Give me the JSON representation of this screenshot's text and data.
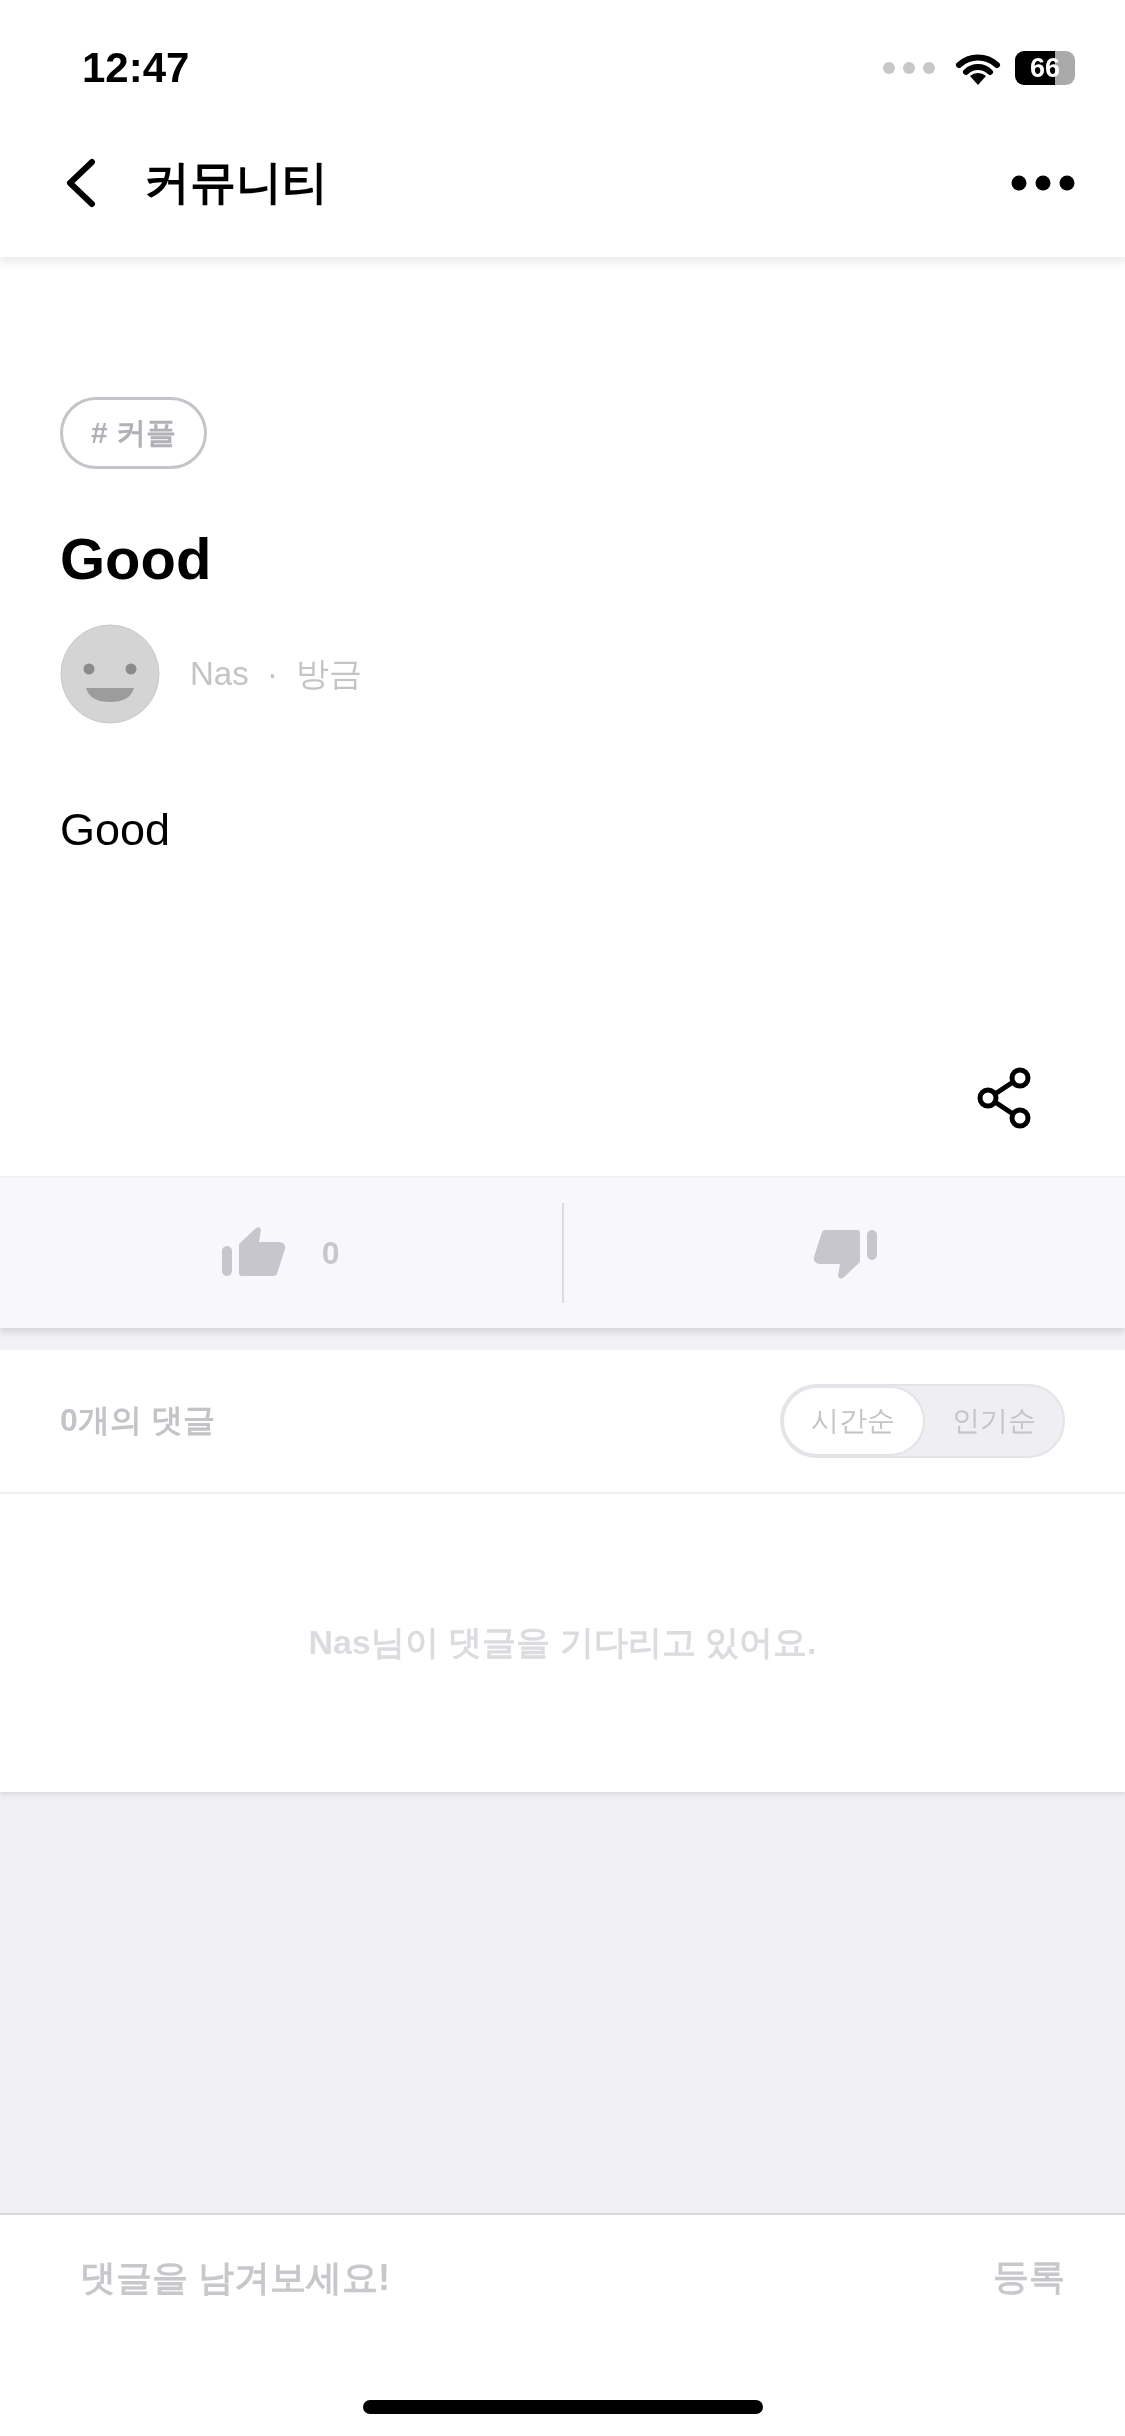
{
  "status_bar": {
    "time": "12:47",
    "battery": "66"
  },
  "header": {
    "title": "커뮤니티"
  },
  "post": {
    "tag": "# 커플",
    "title": "Good",
    "author": "Nas",
    "separator": "·",
    "time": "방금",
    "body": "Good"
  },
  "reactions": {
    "like_count": "0"
  },
  "comments": {
    "count_label": "0개의 댓글",
    "sort_options": [
      {
        "label": "시간순",
        "selected": true
      },
      {
        "label": "인기순",
        "selected": false
      }
    ],
    "empty_message": "Nas님이 댓글을 기다리고 있어요."
  },
  "composer": {
    "placeholder": "댓글을 남겨보세요!",
    "submit": "등록"
  }
}
